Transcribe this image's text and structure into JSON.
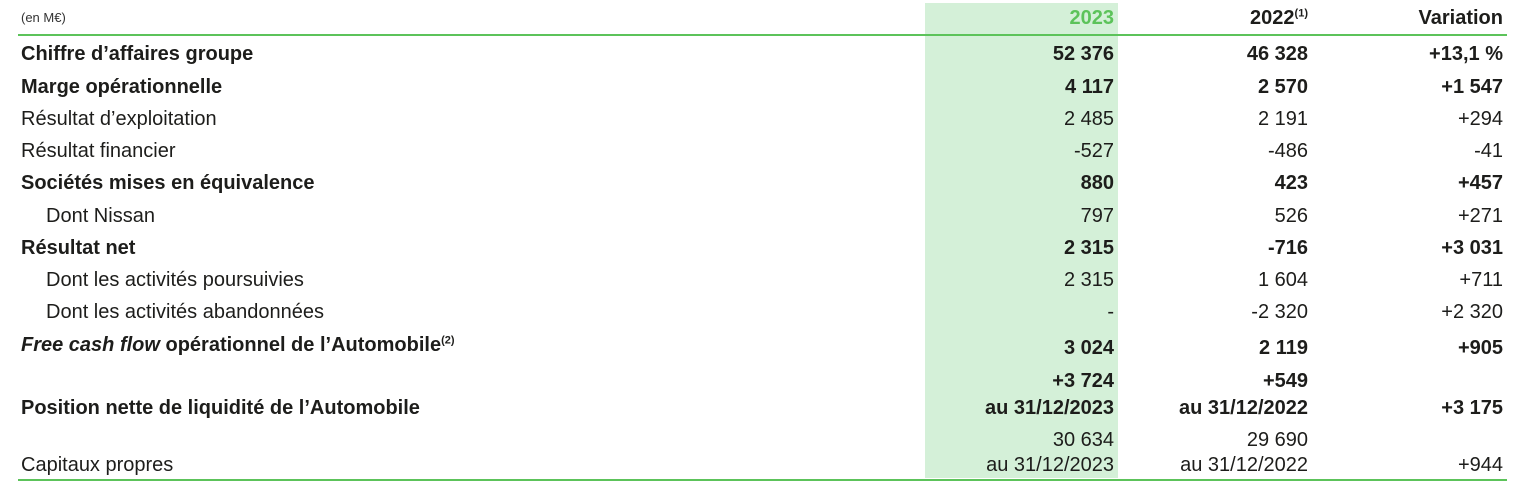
{
  "header": {
    "unit": "(en M€)",
    "col_2023": "2023",
    "col_2022": "2022",
    "col_2022_note": "(1)",
    "col_variation": "Variation"
  },
  "rows": [
    {
      "label": "Chiffre d’affaires groupe",
      "v2023": "52 376",
      "v2022": "46 328",
      "var": "+13,1 %"
    },
    {
      "label": "Marge opérationnelle",
      "v2023": "4 117",
      "v2022": "2 570",
      "var": "+1 547"
    },
    {
      "label": "Résultat d’exploitation",
      "v2023": "2 485",
      "v2022": "2 191",
      "var": "+294"
    },
    {
      "label": "Résultat financier",
      "v2023": "-527",
      "v2022": "-486",
      "var": "-41"
    },
    {
      "label": "Sociétés mises en équivalence",
      "v2023": "880",
      "v2022": "423",
      "var": "+457"
    },
    {
      "label": "Dont Nissan",
      "v2023": "797",
      "v2022": "526",
      "var": "+271"
    },
    {
      "label": "Résultat net",
      "v2023": "2 315",
      "v2022": "-716",
      "var": "+3 031"
    },
    {
      "label": "Dont les activités poursuivies",
      "v2023": "2 315",
      "v2022": "1 604",
      "var": "+711"
    },
    {
      "label": "Dont les activités abandonnées",
      "v2023": "-",
      "v2022": "-2 320",
      "var": "+2 320"
    },
    {
      "label_italic": "Free cash flow",
      "label_rest": " opérationnel de l’Automobile",
      "label_note": "(2)",
      "v2023": "3 024",
      "v2022": "2 119",
      "var": "+905"
    },
    {
      "label": "Position nette de liquidité de l’Automobile",
      "v2023_line1": "+3 724",
      "v2023_line2": "au 31/12/2023",
      "v2022_line1": "+549",
      "v2022_line2": "au 31/12/2022",
      "var": "+3 175"
    },
    {
      "label": "Capitaux propres",
      "v2023_line1": "30 634",
      "v2023_line2": "au 31/12/2023",
      "v2022_line1": "29 690",
      "v2022_line2": "au 31/12/2022",
      "var": "+944"
    }
  ],
  "colors": {
    "accent_green": "#5cc35a",
    "highlight_bg": "#d4f0d8",
    "text": "#1d1d1b"
  }
}
